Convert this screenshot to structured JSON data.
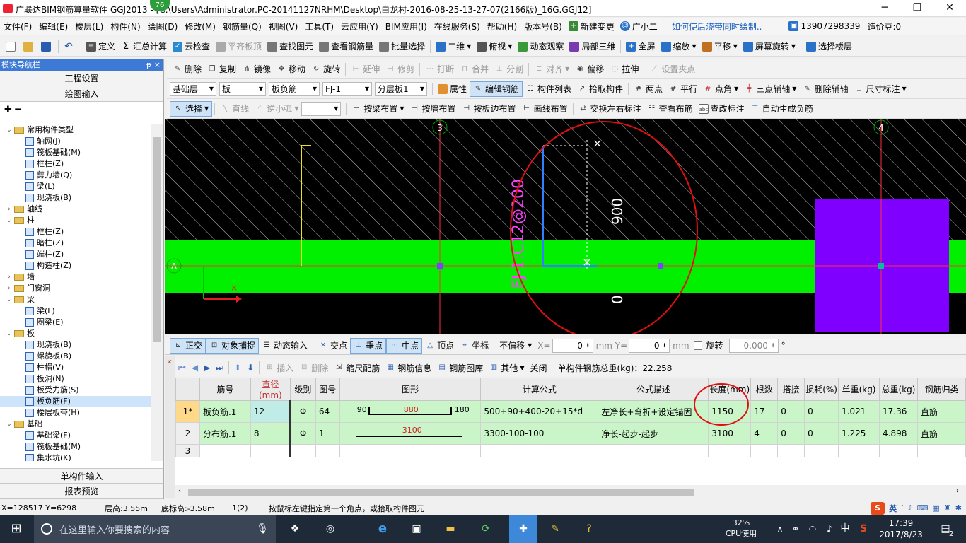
{
  "title": {
    "text": "广联达BIM钢筋算量软件 GGJ2013 - [C:\\Users\\Administrator.PC-20141127NRHM\\Desktop\\白龙村-2016-08-25-13-27-07(2166版)_16G.GGJ12]",
    "badge": "76"
  },
  "window_buttons": [
    "─",
    "❐",
    "✕"
  ],
  "menu": [
    "文件(F)",
    "编辑(E)",
    "楼层(L)",
    "构件(N)",
    "绘图(D)",
    "修改(M)",
    "钢筋量(Q)",
    "视图(V)",
    "工具(T)",
    "云应用(Y)",
    "BIM应用(I)",
    "在线服务(S)",
    "帮助(H)",
    "版本号(B)"
  ],
  "menu_right": {
    "change": "新建变更",
    "guang": "广小二",
    "hint": "如何使后浇带同时绘制..",
    "phone": "13907298339",
    "price": "造价豆:0"
  },
  "toolbar1": [
    "定义",
    "汇总计算",
    "云检查",
    "平齐板顶",
    "查找图元",
    "查看钢筋量",
    "批量选择",
    "二维",
    "俯视",
    "动态观察",
    "局部三维",
    "全屏",
    "缩放",
    "平移",
    "屏幕旋转",
    "选择楼层"
  ],
  "toolbar2": [
    "删除",
    "复制",
    "镜像",
    "移动",
    "旋转",
    "延伸",
    "修剪",
    "打断",
    "合并",
    "分割",
    "对齐",
    "偏移",
    "拉伸",
    "设置夹点"
  ],
  "toolbar3": {
    "combos": [
      "基础层",
      "板",
      "板负筋",
      "FJ-1",
      "分层板1"
    ],
    "buttons": [
      "属性",
      "编辑钢筋",
      "构件列表",
      "拾取构件",
      "两点",
      "平行",
      "点角",
      "三点辅轴",
      "删除辅轴",
      "尺寸标注"
    ]
  },
  "toolbar4": [
    "选择",
    "直线",
    "逆小弧",
    "按梁布置",
    "按墙布置",
    "按板边布置",
    "画线布置",
    "交换左右标注",
    "查看布筋",
    "查改标注",
    "自动生成负筋"
  ],
  "nav": {
    "header": "模块导航栏",
    "header_pin": "ᵽ ×",
    "sections": [
      "工程设置",
      "绘图输入"
    ],
    "bottom_sections": [
      "单构件输入",
      "报表预览"
    ],
    "tree_icons": "✚ ━"
  },
  "tree": [
    {
      "level": 0,
      "toggle": "⌄",
      "label": "常用构件类型",
      "folder": true
    },
    {
      "level": 1,
      "label": "轴网(J)"
    },
    {
      "level": 1,
      "label": "筏板基础(M)"
    },
    {
      "level": 1,
      "label": "框柱(Z)"
    },
    {
      "level": 1,
      "label": "剪力墙(Q)"
    },
    {
      "level": 1,
      "label": "梁(L)"
    },
    {
      "level": 1,
      "label": "现浇板(B)"
    },
    {
      "level": 0,
      "toggle": "›",
      "label": "轴线",
      "folder": true
    },
    {
      "level": 0,
      "toggle": "⌄",
      "label": "柱",
      "folder": true
    },
    {
      "level": 1,
      "label": "框柱(Z)"
    },
    {
      "level": 1,
      "label": "暗柱(Z)"
    },
    {
      "level": 1,
      "label": "端柱(Z)"
    },
    {
      "level": 1,
      "label": "构造柱(Z)"
    },
    {
      "level": 0,
      "toggle": "›",
      "label": "墙",
      "folder": true
    },
    {
      "level": 0,
      "toggle": "›",
      "label": "门窗洞",
      "folder": true
    },
    {
      "level": 0,
      "toggle": "⌄",
      "label": "梁",
      "folder": true
    },
    {
      "level": 1,
      "label": "梁(L)"
    },
    {
      "level": 1,
      "label": "圈梁(E)"
    },
    {
      "level": 0,
      "toggle": "⌄",
      "label": "板",
      "folder": true
    },
    {
      "level": 1,
      "label": "现浇板(B)"
    },
    {
      "level": 1,
      "label": "螺旋板(B)"
    },
    {
      "level": 1,
      "label": "柱帽(V)"
    },
    {
      "level": 1,
      "label": "板洞(N)"
    },
    {
      "level": 1,
      "label": "板受力筋(S)"
    },
    {
      "level": 1,
      "label": "板负筋(F)",
      "selected": true
    },
    {
      "level": 1,
      "label": "楼层板带(H)"
    },
    {
      "level": 0,
      "toggle": "⌄",
      "label": "基础",
      "folder": true
    },
    {
      "level": 1,
      "label": "基础梁(F)"
    },
    {
      "level": 1,
      "label": "筏板基础(M)"
    },
    {
      "level": 1,
      "label": "集水坑(K)"
    }
  ],
  "canvas": {
    "axis_left": "3",
    "axis_right": "4",
    "axis_a": "A",
    "rebar_label": "FJ-1:C12@200",
    "dim_900": "900",
    "dim_0": "0",
    "cursor_x": "×"
  },
  "bottom_toolbar": {
    "buttons": [
      "正交",
      "对象捕捉",
      "动态输入",
      "交点",
      "垂点",
      "中点",
      "顶点",
      "坐标"
    ],
    "offset": "不偏移",
    "x_label": "X=",
    "x_val": "0",
    "y_label": "mm Y=",
    "y_val": "0",
    "unit": "mm",
    "rotate": "旋转",
    "rotate_val": "0.000",
    "deg": "°"
  },
  "grid_toolbar": {
    "buttons": [
      "插入",
      "删除",
      "缩尺配筋",
      "钢筋信息",
      "钢筋图库",
      "其他",
      "关闭"
    ],
    "total": "单构件钢筋总重(kg)：22.258"
  },
  "grid": {
    "headers": [
      "",
      "筋号",
      "直径(mm)",
      "级别",
      "图号",
      "图形",
      "计算公式",
      "公式描述",
      "长度(mm)",
      "根数",
      "搭接",
      "损耗(%)",
      "单重(kg)",
      "总重(kg)",
      "钢筋归类"
    ],
    "rows": [
      {
        "no": "1*",
        "name": "板负筋.1",
        "dia": "12",
        "grade": "Φ",
        "fig": "64",
        "shape_l": "90",
        "shape_m": "880",
        "shape_r": "180",
        "formula": "500+90+400-20+15*d",
        "desc": "左净长+弯折+设定锚固",
        "len": "1150",
        "count": "17",
        "lap": "0",
        "loss": "0",
        "unit_w": "1.021",
        "total_w": "17.36",
        "cat": "直筋"
      },
      {
        "no": "2",
        "name": "分布筋.1",
        "dia": "8",
        "grade": "Φ",
        "fig": "1",
        "shape_l": "",
        "shape_m": "3100",
        "shape_r": "",
        "formula": "3300-100-100",
        "desc": "净长-起步-起步",
        "len": "3100",
        "count": "4",
        "lap": "0",
        "loss": "0",
        "unit_w": "1.225",
        "total_w": "4.898",
        "cat": "直筋"
      },
      {
        "no": "3",
        "name": "",
        "dia": "",
        "grade": "",
        "fig": "",
        "shape_l": "",
        "shape_m": "",
        "shape_r": "",
        "formula": "",
        "desc": "",
        "len": "",
        "count": "",
        "lap": "",
        "loss": "",
        "unit_w": "",
        "total_w": "",
        "cat": ""
      }
    ]
  },
  "status": {
    "coords": "X=128517 Y=6298",
    "floor_h": "层高:3.55m",
    "bottom_h": "底标高:-3.58m",
    "count": "1(2)",
    "hint": "按鼠标左键指定第一个角点，或拾取构件图元",
    "ime": "英"
  },
  "taskbar": {
    "search": "在这里输入你要搜索的内容",
    "cpu": "32%",
    "cpu_label": "CPU使用",
    "time": "17:39",
    "date": "2017/8/23",
    "lang": "中",
    "notif": "2"
  }
}
